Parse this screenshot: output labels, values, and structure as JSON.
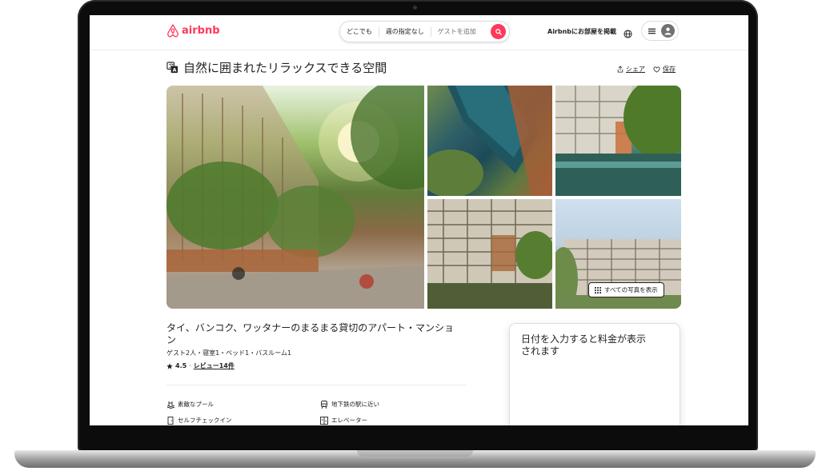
{
  "header": {
    "logo_text": "airbnb",
    "search": {
      "location": "どこでも",
      "dates": "週の指定なし",
      "guests": "ゲストを追加"
    },
    "host_link": "Airbnbにお部屋を掲載"
  },
  "listing": {
    "title": "自然に囲まれたリラックスできる空間",
    "share_label": "シェア",
    "save_label": "保存",
    "show_all_photos": "すべての写真を表示",
    "subtitle": "タイ、バンコク、ワッタナーのまるまる貸切のアパート・マンション",
    "details": "ゲスト2人・寝室1・ベッド1・バスルーム1",
    "rating": "4.5",
    "rating_sep": "·",
    "reviews": "レビュー14件"
  },
  "amenities": [
    {
      "label": "素敵なプール",
      "icon": "pool-icon"
    },
    {
      "label": "地下鉄の駅に近い",
      "icon": "train-icon"
    },
    {
      "label": "セルフチェックイン",
      "icon": "door-icon"
    },
    {
      "label": "エレベーター",
      "icon": "elevator-icon"
    }
  ],
  "booking": {
    "prompt": "日付を入力すると料金が表示されます"
  },
  "colors": {
    "brand": "#FF385C",
    "text": "#222222",
    "muted": "#717171"
  }
}
